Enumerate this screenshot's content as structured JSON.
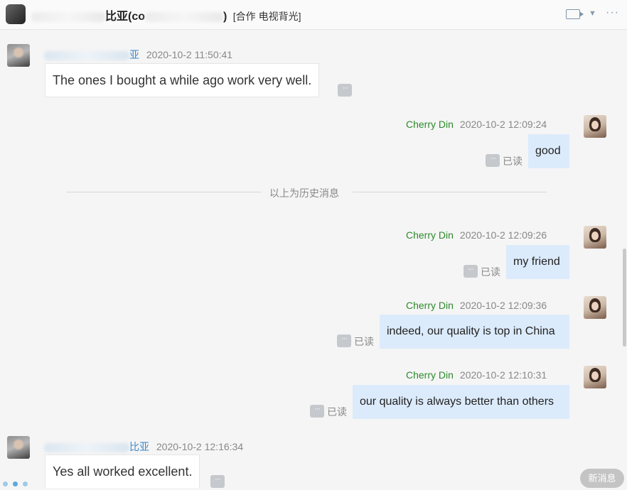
{
  "header": {
    "title_visible": "比亚(co",
    "title_visible_2": ") ",
    "tag": "[合作 电视背光]"
  },
  "messages": [
    {
      "side": "left",
      "name_visible": "亚",
      "time": "2020-10-2 11:50:41",
      "text": "The ones I bought a while ago work very well."
    },
    {
      "side": "right",
      "name": "Cherry Din",
      "time": "2020-10-2 12:09:24",
      "text": "good",
      "read": "已读"
    },
    {
      "side": "right",
      "name": "Cherry Din",
      "time": "2020-10-2 12:09:26",
      "text": "my friend",
      "read": "已读"
    },
    {
      "side": "right",
      "name": "Cherry Din",
      "time": "2020-10-2 12:09:36",
      "text": "indeed, our quality is top in China",
      "read": "已读"
    },
    {
      "side": "right",
      "name": "Cherry Din",
      "time": "2020-10-2 12:10:31",
      "text": "our quality is always better than others",
      "read": "已读"
    },
    {
      "side": "left",
      "name_visible": "比亚",
      "time": "2020-10-2 12:16:34",
      "text": "Yes all worked excellent."
    }
  ],
  "divider": "以上为历史消息",
  "new_messages_button": "新消息",
  "more_glyph": "···",
  "header_more_glyph": "···",
  "chevron_glyph": "▼"
}
